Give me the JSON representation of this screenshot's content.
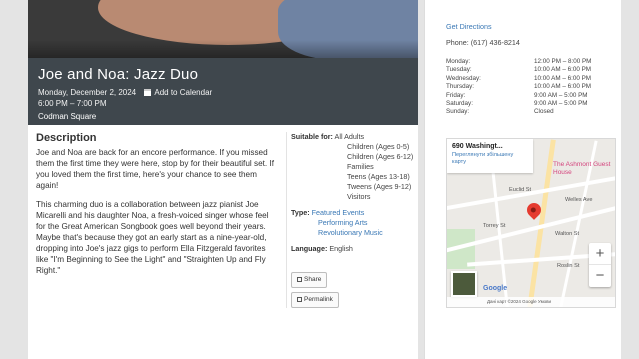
{
  "event": {
    "title": "Joe and Noa: Jazz Duo",
    "date": "Monday, December 2, 2024",
    "add_calendar": "Add to Calendar",
    "time": "6:00 PM – 7:00 PM",
    "location": "Codman Square"
  },
  "description": {
    "heading": "Description",
    "paragraphs": [
      "Joe and Noa are back for an encore performance. If you missed them the first time they were here, stop by for their beautiful set. If you loved them the first time, here's your chance to see them again!",
      "This charming duo is a collaboration between jazz pianist Joe Micarelli and his daughter Noa, a fresh-voiced singer whose feel for the Great American Songbook goes well beyond their years. Maybe that's because they got an early start as a nine-year-old, dropping into Joe's jazz gigs to perform Ella Fitzgerald favorites like \"I'm Beginning to See the Light\" and \"Straighten Up and Fly Right.\""
    ]
  },
  "details": {
    "suitable_label": "Suitable for:",
    "suitable": [
      "All Adults",
      "Children (Ages 0-5)",
      "Children (Ages 6-12)",
      "Families",
      "Teens (Ages 13-18)",
      "Tweens (Ages 9-12)",
      "Visitors"
    ],
    "type_label": "Type:",
    "types": [
      "Featured Events",
      "Performing Arts",
      "Revolutionary Music"
    ],
    "language_label": "Language:",
    "language": "English",
    "share": "Share",
    "permalink": "Permalink"
  },
  "branch": {
    "get_directions": "Get Directions",
    "phone": "Phone: (617) 436-8214",
    "hours": [
      {
        "day": "Monday:",
        "time": "12:00 PM – 8:00 PM"
      },
      {
        "day": "Tuesday:",
        "time": "10:00 AM – 6:00 PM"
      },
      {
        "day": "Wednesday:",
        "time": "10:00 AM – 6:00 PM"
      },
      {
        "day": "Thursday:",
        "time": "10:00 AM – 6:00 PM"
      },
      {
        "day": "Friday:",
        "time": "9:00 AM – 5:00 PM"
      },
      {
        "day": "Saturday:",
        "time": "9:00 AM – 5:00 PM"
      },
      {
        "day": "Sunday:",
        "time": "Closed"
      }
    ]
  },
  "map": {
    "place": "690 Washingt...",
    "view_larger": "Переглянути збільшену карту",
    "poi": "The Ashmont Guest House",
    "streets": [
      "Euclid St",
      "Welles Ave",
      "Torrey St",
      "Walton St",
      "Roslin St"
    ],
    "zoom_in": "+",
    "zoom_out": "−",
    "logo": "Google",
    "footer": "Дані карт ©2024 Google   Умови"
  },
  "colors": {
    "banner": "#3f474d",
    "link": "#3a78b5",
    "pin": "#e53b30"
  }
}
